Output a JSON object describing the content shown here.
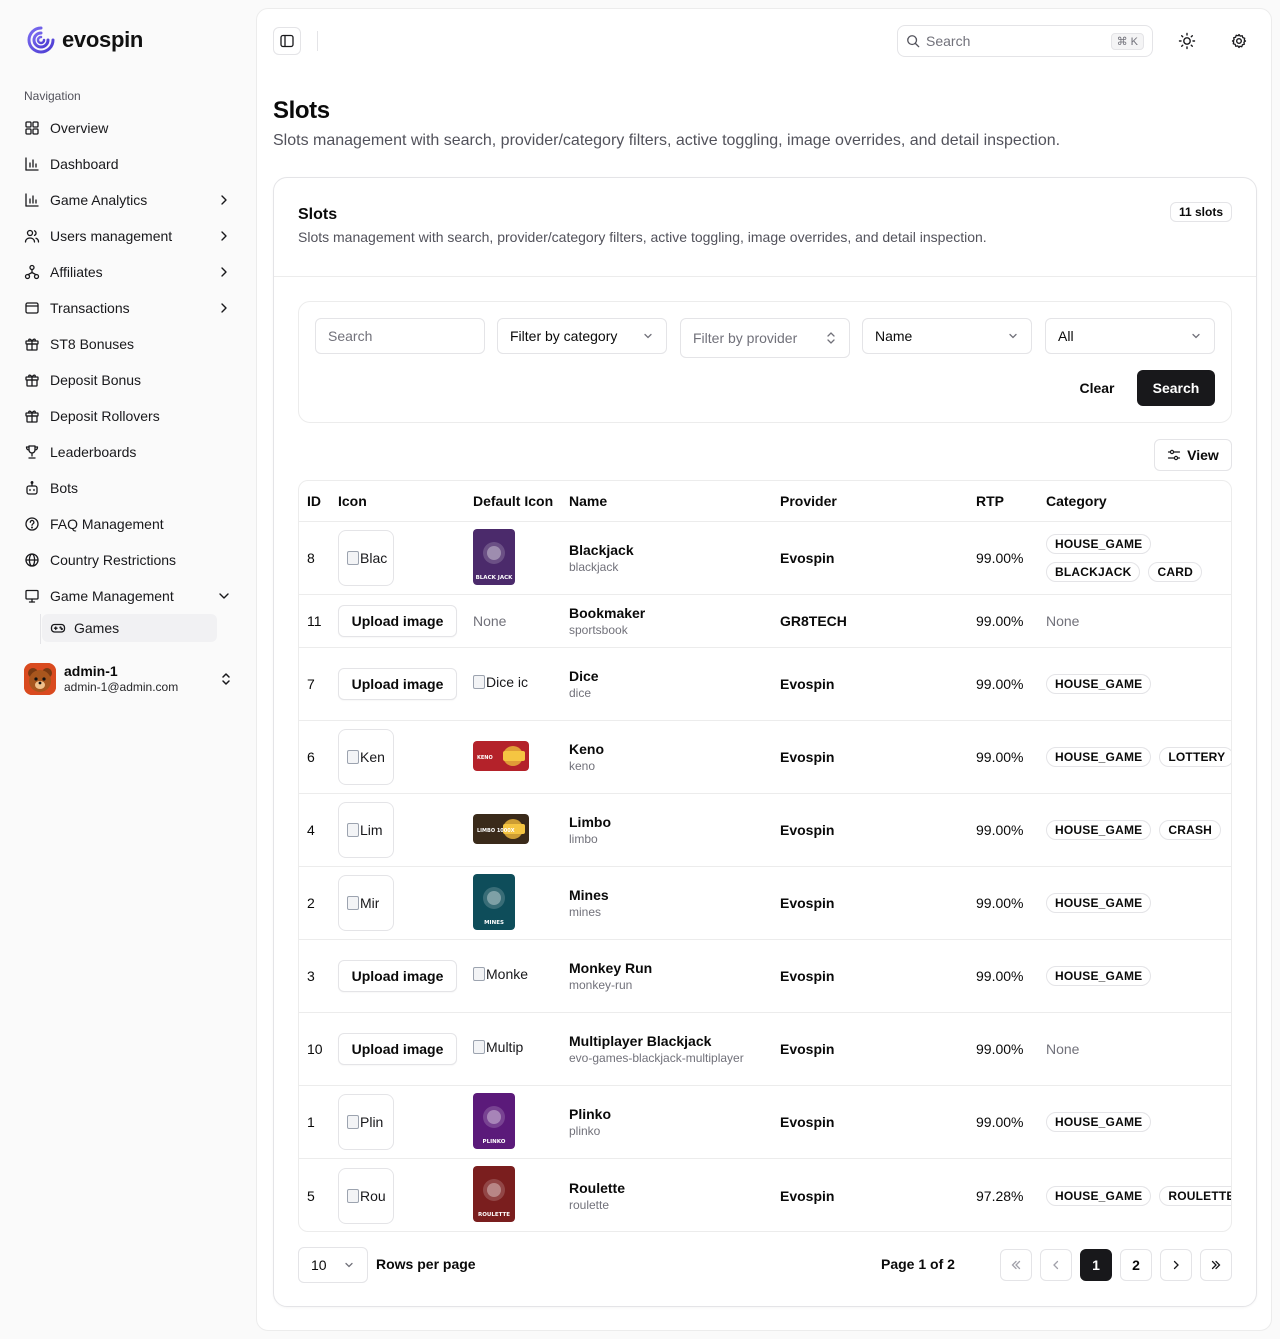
{
  "brand": {
    "name": "evospin"
  },
  "sidebar": {
    "section_label": "Navigation",
    "items": [
      {
        "label": "Overview",
        "icon": "layout-grid-icon",
        "has_chevron": false
      },
      {
        "label": "Dashboard",
        "icon": "bar-chart-icon",
        "has_chevron": false
      },
      {
        "label": "Game Analytics",
        "icon": "bar-chart-icon",
        "has_chevron": true
      },
      {
        "label": "Users management",
        "icon": "users-icon",
        "has_chevron": true
      },
      {
        "label": "Affiliates",
        "icon": "network-icon",
        "has_chevron": true
      },
      {
        "label": "Transactions",
        "icon": "wallet-icon",
        "has_chevron": true
      },
      {
        "label": "ST8 Bonuses",
        "icon": "gift-icon",
        "has_chevron": false
      },
      {
        "label": "Deposit Bonus",
        "icon": "gift-icon",
        "has_chevron": false
      },
      {
        "label": "Deposit Rollovers",
        "icon": "gift-icon",
        "has_chevron": false
      },
      {
        "label": "Leaderboards",
        "icon": "trophy-icon",
        "has_chevron": false
      },
      {
        "label": "Bots",
        "icon": "bot-icon",
        "has_chevron": false
      },
      {
        "label": "FAQ Management",
        "icon": "help-circle-icon",
        "has_chevron": false
      },
      {
        "label": "Country Restrictions",
        "icon": "globe-icon",
        "has_chevron": false
      },
      {
        "label": "Game Management",
        "icon": "monitor-icon",
        "has_chevron": true,
        "expanded": true
      }
    ],
    "sub_items": [
      {
        "label": "Games",
        "icon": "gamepad-icon",
        "active": true
      }
    ],
    "user": {
      "name": "admin-1",
      "email": "admin-1@admin.com"
    }
  },
  "topbar": {
    "search_placeholder": "Search",
    "shortcut": "⌘ K"
  },
  "page": {
    "title": "Slots",
    "subtitle": "Slots management with search, provider/category filters, active toggling, image overrides, and detail inspection."
  },
  "card": {
    "title": "Slots",
    "subtitle": "Slots management with search, provider/category filters, active toggling, image overrides, and detail inspection.",
    "count": "11 slots"
  },
  "filters": {
    "search_placeholder": "Search",
    "category": "Filter by category",
    "provider": "Filter by provider",
    "sort": "Name",
    "status": "All",
    "clear_label": "Clear",
    "search_label": "Search"
  },
  "view_label": "View",
  "table": {
    "columns": [
      "ID",
      "Icon",
      "Default Icon",
      "Name",
      "Provider",
      "RTP",
      "Category"
    ],
    "upload_label": "Upload image",
    "rows": [
      {
        "id": "8",
        "icon": "image",
        "icon_alt": "Blac",
        "default": "thumb",
        "default_alt": "",
        "name": "Blackjack",
        "slug": "blackjack",
        "provider": "Evospin",
        "rtp": "99.00%",
        "categories": [
          "HOUSE_GAME",
          "BLACKJACK",
          "CARD"
        ],
        "thumb_color": "#4b2a6b",
        "thumb_caption": "BLACK JACK"
      },
      {
        "id": "11",
        "icon": "upload",
        "default": "none",
        "default_text": "None",
        "name": "Bookmaker",
        "slug": "sportsbook",
        "provider": "GR8TECH",
        "rtp": "99.00%",
        "categories": [],
        "cat_none": "None"
      },
      {
        "id": "7",
        "icon": "upload",
        "default": "broken",
        "default_alt": "Dice ic",
        "name": "Dice",
        "slug": "dice",
        "provider": "Evospin",
        "rtp": "99.00%",
        "categories": [
          "HOUSE_GAME"
        ]
      },
      {
        "id": "6",
        "icon": "image",
        "icon_alt": "Ken",
        "default": "wide",
        "name": "Keno",
        "slug": "keno",
        "provider": "Evospin",
        "rtp": "99.00%",
        "categories": [
          "HOUSE_GAME",
          "LOTTERY"
        ],
        "thumb_color": "#b4222a",
        "thumb_caption": "KENO"
      },
      {
        "id": "4",
        "icon": "image",
        "icon_alt": "Lim",
        "default": "wide",
        "name": "Limbo",
        "slug": "limbo",
        "provider": "Evospin",
        "rtp": "99.00%",
        "categories": [
          "HOUSE_GAME",
          "CRASH"
        ],
        "thumb_color": "#3a2a1a",
        "thumb_caption": "LIMBO 1000X"
      },
      {
        "id": "2",
        "icon": "image",
        "icon_alt": "Mir",
        "default": "thumb",
        "name": "Mines",
        "slug": "mines",
        "provider": "Evospin",
        "rtp": "99.00%",
        "categories": [
          "HOUSE_GAME"
        ],
        "thumb_color": "#0e4d5a",
        "thumb_caption": "MINES"
      },
      {
        "id": "3",
        "icon": "upload",
        "default": "broken",
        "default_alt": "Monke",
        "name": "Monkey Run",
        "slug": "monkey-run",
        "provider": "Evospin",
        "rtp": "99.00%",
        "categories": [
          "HOUSE_GAME"
        ]
      },
      {
        "id": "10",
        "icon": "upload",
        "default": "broken",
        "default_alt": "Multip",
        "name": "Multiplayer Blackjack",
        "slug": "evo-games-blackjack-multiplayer",
        "provider": "Evospin",
        "rtp": "99.00%",
        "categories": [],
        "cat_none": "None"
      },
      {
        "id": "1",
        "icon": "image",
        "icon_alt": "Plin",
        "default": "thumb",
        "name": "Plinko",
        "slug": "plinko",
        "provider": "Evospin",
        "rtp": "99.00%",
        "categories": [
          "HOUSE_GAME"
        ],
        "thumb_color": "#5b1a7a",
        "thumb_caption": "PLINKO"
      },
      {
        "id": "5",
        "icon": "image",
        "icon_alt": "Rou",
        "default": "thumb",
        "name": "Roulette",
        "slug": "roulette",
        "provider": "Evospin",
        "rtp": "97.28%",
        "categories": [
          "HOUSE_GAME",
          "ROULETTE"
        ],
        "thumb_color": "#7a1e1e",
        "thumb_caption": "ROULETTE"
      }
    ]
  },
  "pagination": {
    "rows_per_page_value": "10",
    "rows_per_page_label": "Rows per page",
    "page_info": "Page 1 of 2",
    "pages": [
      "1",
      "2"
    ]
  },
  "colors": {
    "primary": "#18181b",
    "brand": "#6d5ae6",
    "border": "#e4e4e7"
  }
}
